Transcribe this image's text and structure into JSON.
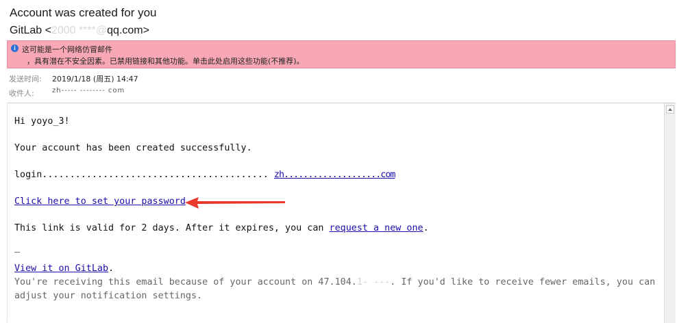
{
  "email": {
    "subject": "Account was created for you",
    "from_prefix": "GitLab <",
    "from_blurred": "2000 ****@",
    "from_domain": "qq.com>"
  },
  "warning": {
    "line1": "这可能是一个网络仿冒邮件",
    "line2": "，具有潜在不安全因素。已禁用链接和其他功能。单击此处启用这些功能(不推荐)。",
    "color": "#f7a8b4"
  },
  "meta": {
    "sent_label": "发送时间:",
    "sent_value": "2019/1/18 (周五) 14:47",
    "recipient_label": "收件人:",
    "recipient_value": "zh----- -------- com"
  },
  "body": {
    "greeting": "Hi yoyo_3!",
    "line_created": "Your account has been created successfully.",
    "login_label": "login.........................................",
    "login_value": "zh....................com",
    "set_password_link": "Click here to set your password",
    "valid_text": "This link is valid for 2 days. After it expires, you can ",
    "request_link": "request a new one",
    "valid_end": ".",
    "separator": "—",
    "view_link": "View it on GitLab",
    "view_end": ".",
    "footer1_a": "You're receiving this email because of your account on 47.104.",
    "footer1_blur": "1- ---",
    "footer1_b": ". If you'd like to receive fewer emails, you can",
    "footer2": "adjust your notification settings."
  },
  "colors": {
    "link": "#1a0dab",
    "arrow": "#e8392d"
  }
}
